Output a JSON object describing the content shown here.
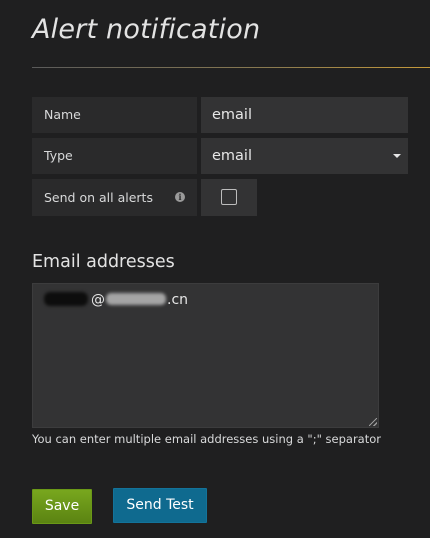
{
  "page": {
    "title": "Alert notification"
  },
  "form": {
    "name_label": "Name",
    "name_value": "email",
    "type_label": "Type",
    "type_value": "email",
    "send_all_label": "Send on all alerts",
    "send_all_checked": false,
    "info_glyph": "i"
  },
  "email_section": {
    "title": "Email addresses",
    "at_sign": "@",
    "domain_suffix": ".cn",
    "help_text": "You can enter multiple email addresses using a \";\" separator"
  },
  "buttons": {
    "save_label": "Save",
    "send_test_label": "Send Test"
  },
  "colors": {
    "save": "#6a9817",
    "send_test": "#0f6a8f",
    "accent_rule": "#c69a3a"
  },
  "icons": {
    "info": "info-icon",
    "dropdown": "chevron-down-icon"
  }
}
